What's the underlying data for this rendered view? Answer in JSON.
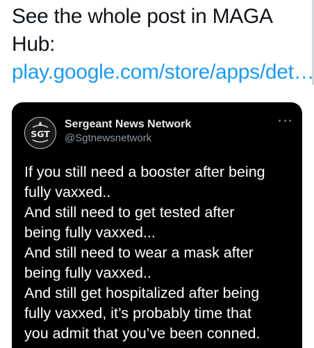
{
  "tweet": {
    "text_prefix": "See the whole post in MAGA Hub: ",
    "link_text": "play.google.com/store/apps/det…"
  },
  "embed": {
    "display_name": "Sergeant News Network",
    "handle": "@Sgtnewsnetwork",
    "avatar_text": "SGT",
    "icon": "more-horizontal-icon",
    "body_lines": [
      "If you still need a booster after being",
      "fully vaxxed..",
      "And still need to get tested after",
      "being fully vaxxed...",
      "And still need to wear a mask after",
      "being fully vaxxed..",
      "And still get hospitalized after being",
      "fully vaxxed, it’s probably time that",
      "you admit that you’ve been conned."
    ]
  },
  "colors": {
    "link": "#1d9bf0",
    "card_background": "#000000",
    "text_primary": "#0f1419"
  }
}
